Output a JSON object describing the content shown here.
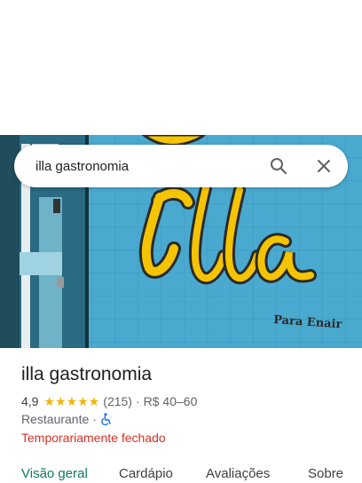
{
  "search": {
    "query": "illa gastronomia",
    "search_icon": "search-icon",
    "close_icon": "close-icon"
  },
  "hero": {
    "sign_text": "Illa",
    "sign_subtext": "Para Enair"
  },
  "place": {
    "name": "illa gastronomia",
    "rating": "4,9",
    "stars": 5,
    "reviews": "(215)",
    "separator": "·",
    "price": "R$ 40–60",
    "category": "Restaurante",
    "category_separator": "·",
    "accessibility_icon": "wheelchair-icon",
    "status": "Temporariamente fechado"
  },
  "tabs": [
    {
      "label": "Visão geral",
      "active": true
    },
    {
      "label": "Cardápio",
      "active": false
    },
    {
      "label": "Avaliações",
      "active": false
    },
    {
      "label": "Sobre",
      "active": false
    }
  ],
  "colors": {
    "star": "#f4b400",
    "closed_status": "#d93025",
    "active_tab": "#0b7a63",
    "sign_yellow": "#f5c400",
    "wall_blue": "#4aa9cf"
  }
}
